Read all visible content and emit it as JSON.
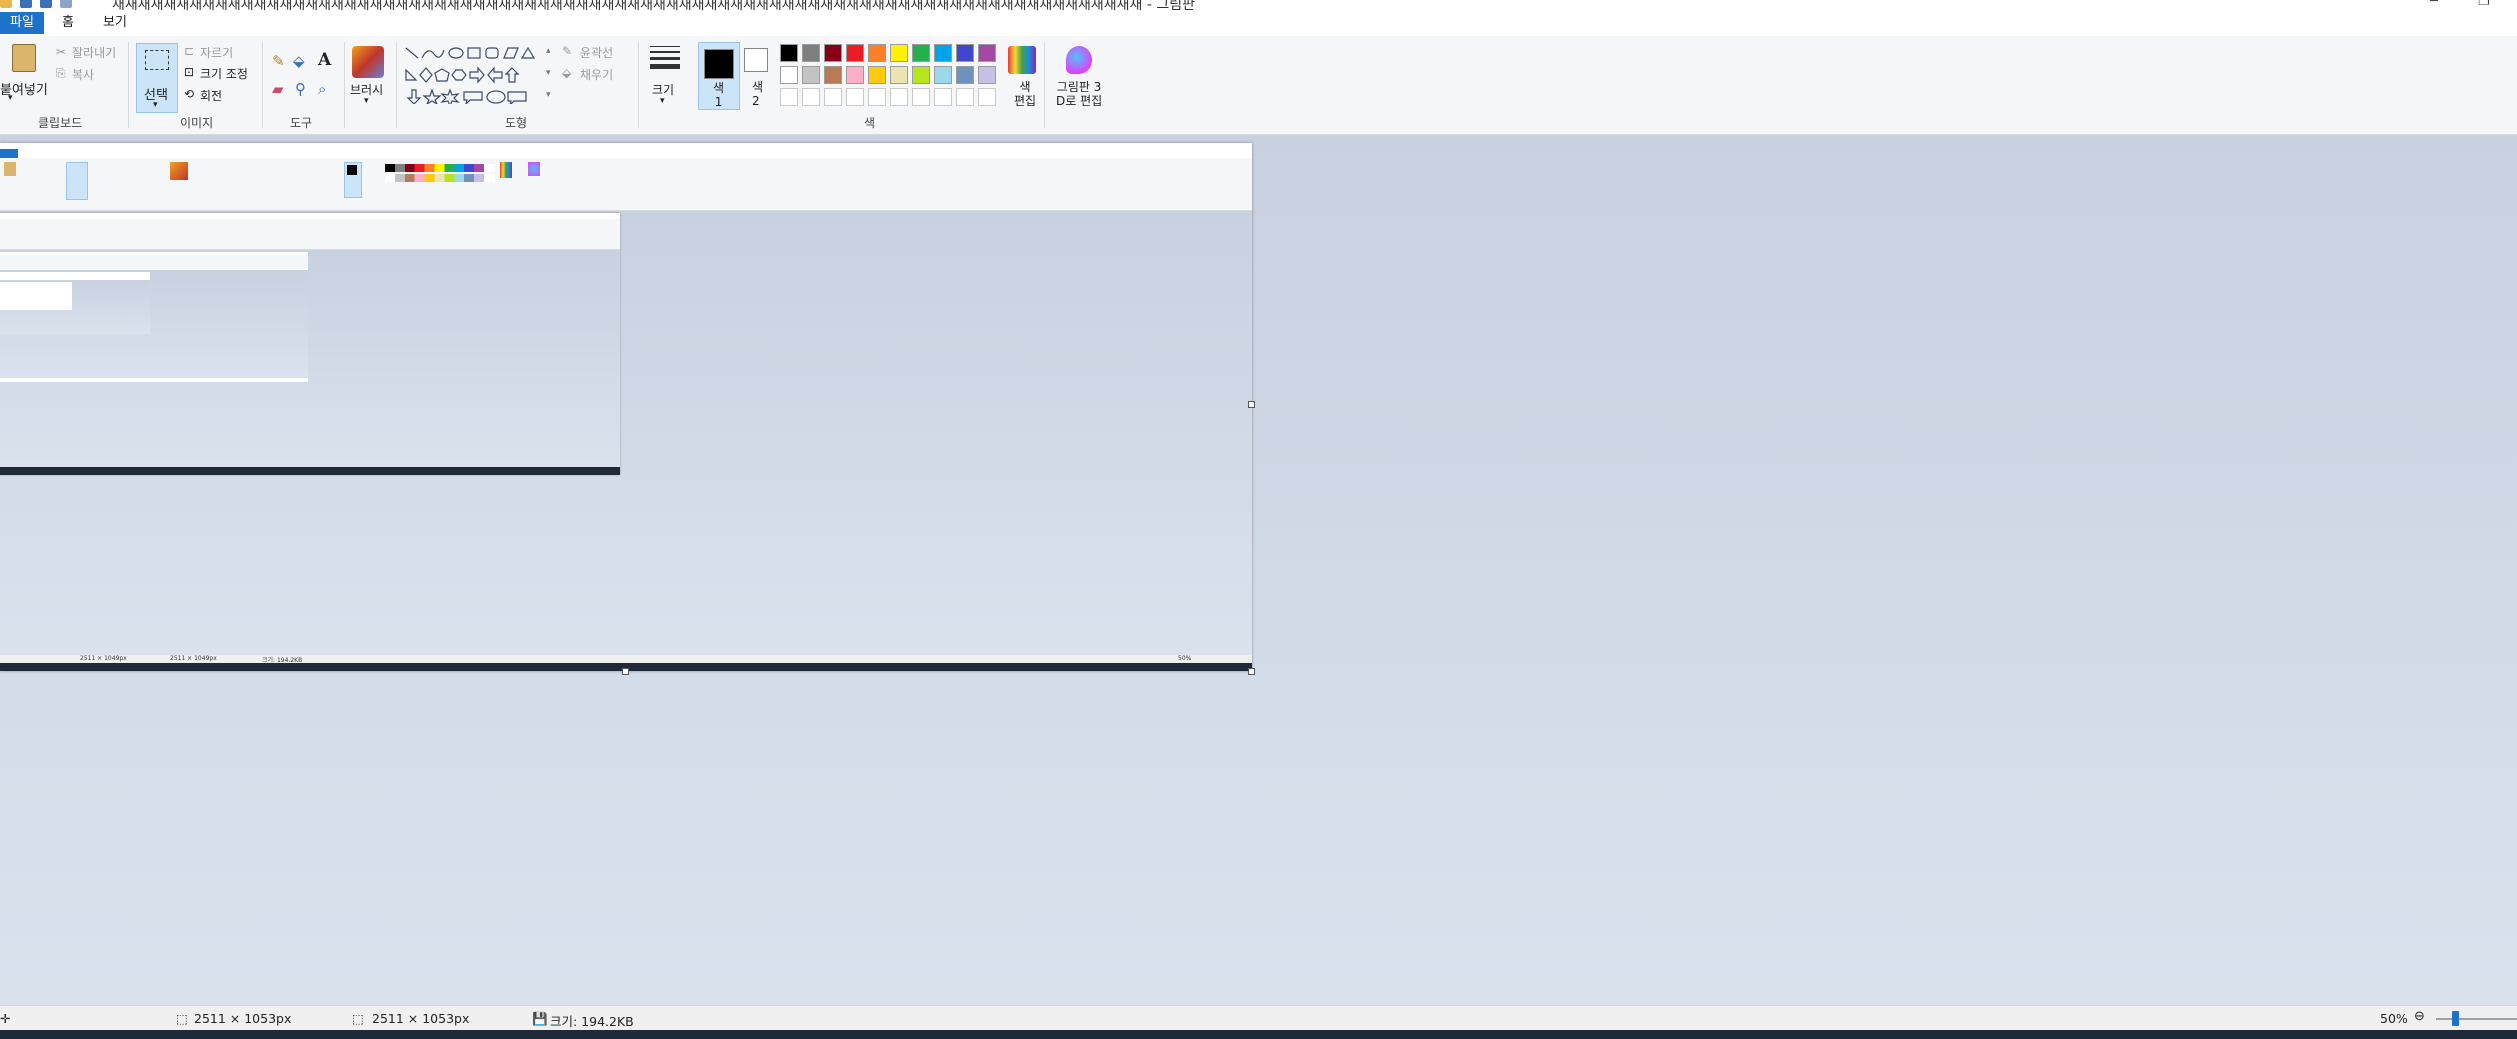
{
  "window": {
    "title": "새새새새새새새새새새새새새새새새새새새새새새새새새새새새새새새새새새새새새새새새새새새새새새새새새새새새새새새새새새새새새새새새새새새새새새새새새새새새새새새새 - 그림판"
  },
  "tabs": [
    "파일",
    "홈",
    "보기"
  ],
  "ribbon": {
    "clipboard": {
      "paste": "붙여넣기",
      "cut": "잘라내기",
      "copy": "복사",
      "group": "클립보드"
    },
    "image": {
      "select": "선택",
      "crop": "자르기",
      "resize": "크기 조정",
      "rotate": "회전",
      "group": "이미지"
    },
    "tools": {
      "group": "도구"
    },
    "brushes": {
      "label": "브러시"
    },
    "shapes": {
      "outline": "윤곽선",
      "fill": "채우기",
      "group": "도형"
    },
    "size": {
      "label": "크기"
    },
    "color1": {
      "label": "색\n1"
    },
    "color2": {
      "label": "색\n2"
    },
    "colors": {
      "group": "색",
      "edit": "색\n편집"
    },
    "paint3d": {
      "label": "그림판 3\nD로 편집"
    }
  },
  "palette": [
    "#000000",
    "#7f7f7f",
    "#880015",
    "#ed1c24",
    "#ff7f27",
    "#fff200",
    "#22b14c",
    "#00a2e8",
    "#3f48cc",
    "#a349a4",
    "#ffffff",
    "#c3c3c3",
    "#b97a57",
    "#ffaec9",
    "#ffc90e",
    "#efe4b0",
    "#b5e61d",
    "#99d9ea",
    "#7092be",
    "#c8bfe7"
  ],
  "statusbar": {
    "cursor_pos": "",
    "selection_size": "2511 × 1053px",
    "image_size": "2511 × 1053px",
    "file_size": "크기: 194.2KB",
    "zoom": "50%"
  },
  "nested": {
    "status1": "2511 × 1049px",
    "status2": "2511 × 1049px",
    "file": "크기: 194.2KB",
    "zoom": "50%"
  }
}
